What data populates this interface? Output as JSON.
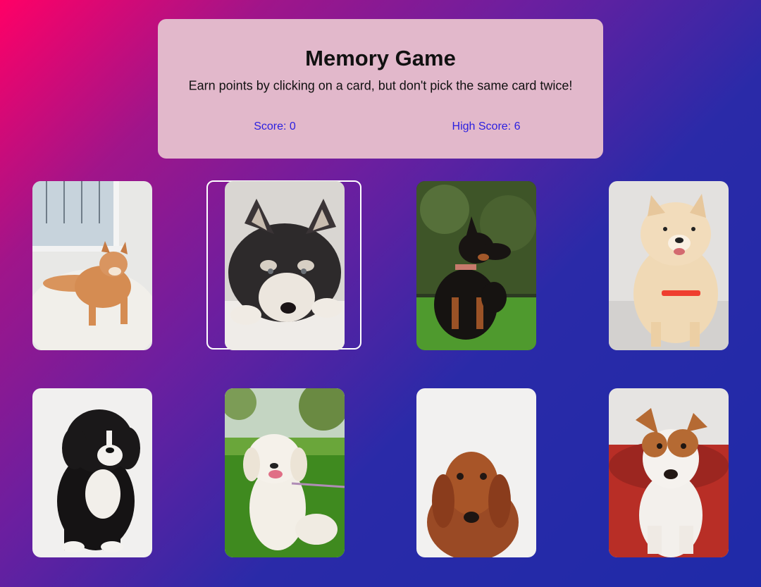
{
  "header": {
    "title": "Memory Game",
    "subtitle": "Earn points by clicking on a card, but don't pick the same card twice!",
    "score_text": "Score: 0",
    "high_score_text": "High Score: 6"
  },
  "colors": {
    "panel": "#e2b8cb",
    "score_text": "#2a1fe0",
    "gradient_start": "#ff0066",
    "gradient_end": "#1f2aa8"
  },
  "cards": [
    {
      "id": "shiba-inu",
      "depicts": "shiba inu puppy on fluffy white rug by window"
    },
    {
      "id": "husky",
      "depicts": "husky puppy lying down"
    },
    {
      "id": "doberman",
      "depicts": "black and tan dog sitting on grass"
    },
    {
      "id": "pomeranian",
      "depicts": "fluffy cream pomeranian smiling"
    },
    {
      "id": "bernedoodle",
      "depicts": "black and white fluffy puppy sitting"
    },
    {
      "id": "golden-retriever",
      "depicts": "white golden retriever on grass"
    },
    {
      "id": "dachshund",
      "depicts": "red dachshund portrait"
    },
    {
      "id": "jack-russell",
      "depicts": "brown and white terrier on red cushion"
    }
  ]
}
